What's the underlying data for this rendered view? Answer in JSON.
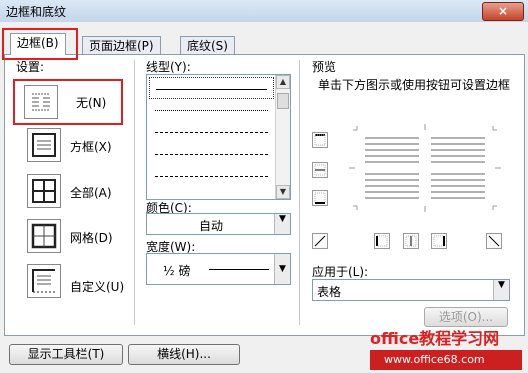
{
  "window": {
    "title": "边框和底纹",
    "close": "×"
  },
  "tabs": [
    {
      "label": "边框(B)"
    },
    {
      "label": "页面边框(P)"
    },
    {
      "label": "底纹(S)"
    }
  ],
  "settings": {
    "heading": "设置:",
    "items": [
      {
        "label": "无(N)",
        "icon": "border-none-icon"
      },
      {
        "label": "方框(X)",
        "icon": "border-box-icon"
      },
      {
        "label": "全部(A)",
        "icon": "border-all-icon"
      },
      {
        "label": "网格(D)",
        "icon": "border-grid-icon"
      },
      {
        "label": "自定义(U)",
        "icon": "border-custom-icon"
      }
    ]
  },
  "line_style": {
    "label": "线型(Y):"
  },
  "color": {
    "label": "颜色(C):",
    "value": "自动"
  },
  "width": {
    "label": "宽度(W):",
    "value": "½ 磅"
  },
  "preview": {
    "heading": "预览",
    "hint": "单击下方图示或使用按钮可设置边框"
  },
  "apply_to": {
    "label": "应用于(L):",
    "value": "表格"
  },
  "buttons": {
    "options": "选项(O)...",
    "show_toolbar": "显示工具栏(T)",
    "horizontal_line": "横线(H)..."
  },
  "watermark": {
    "brand": "office教程学习网",
    "url": "www.office68.com"
  },
  "colors": {
    "highlight": "#e02020",
    "accent": "#c6442a"
  }
}
